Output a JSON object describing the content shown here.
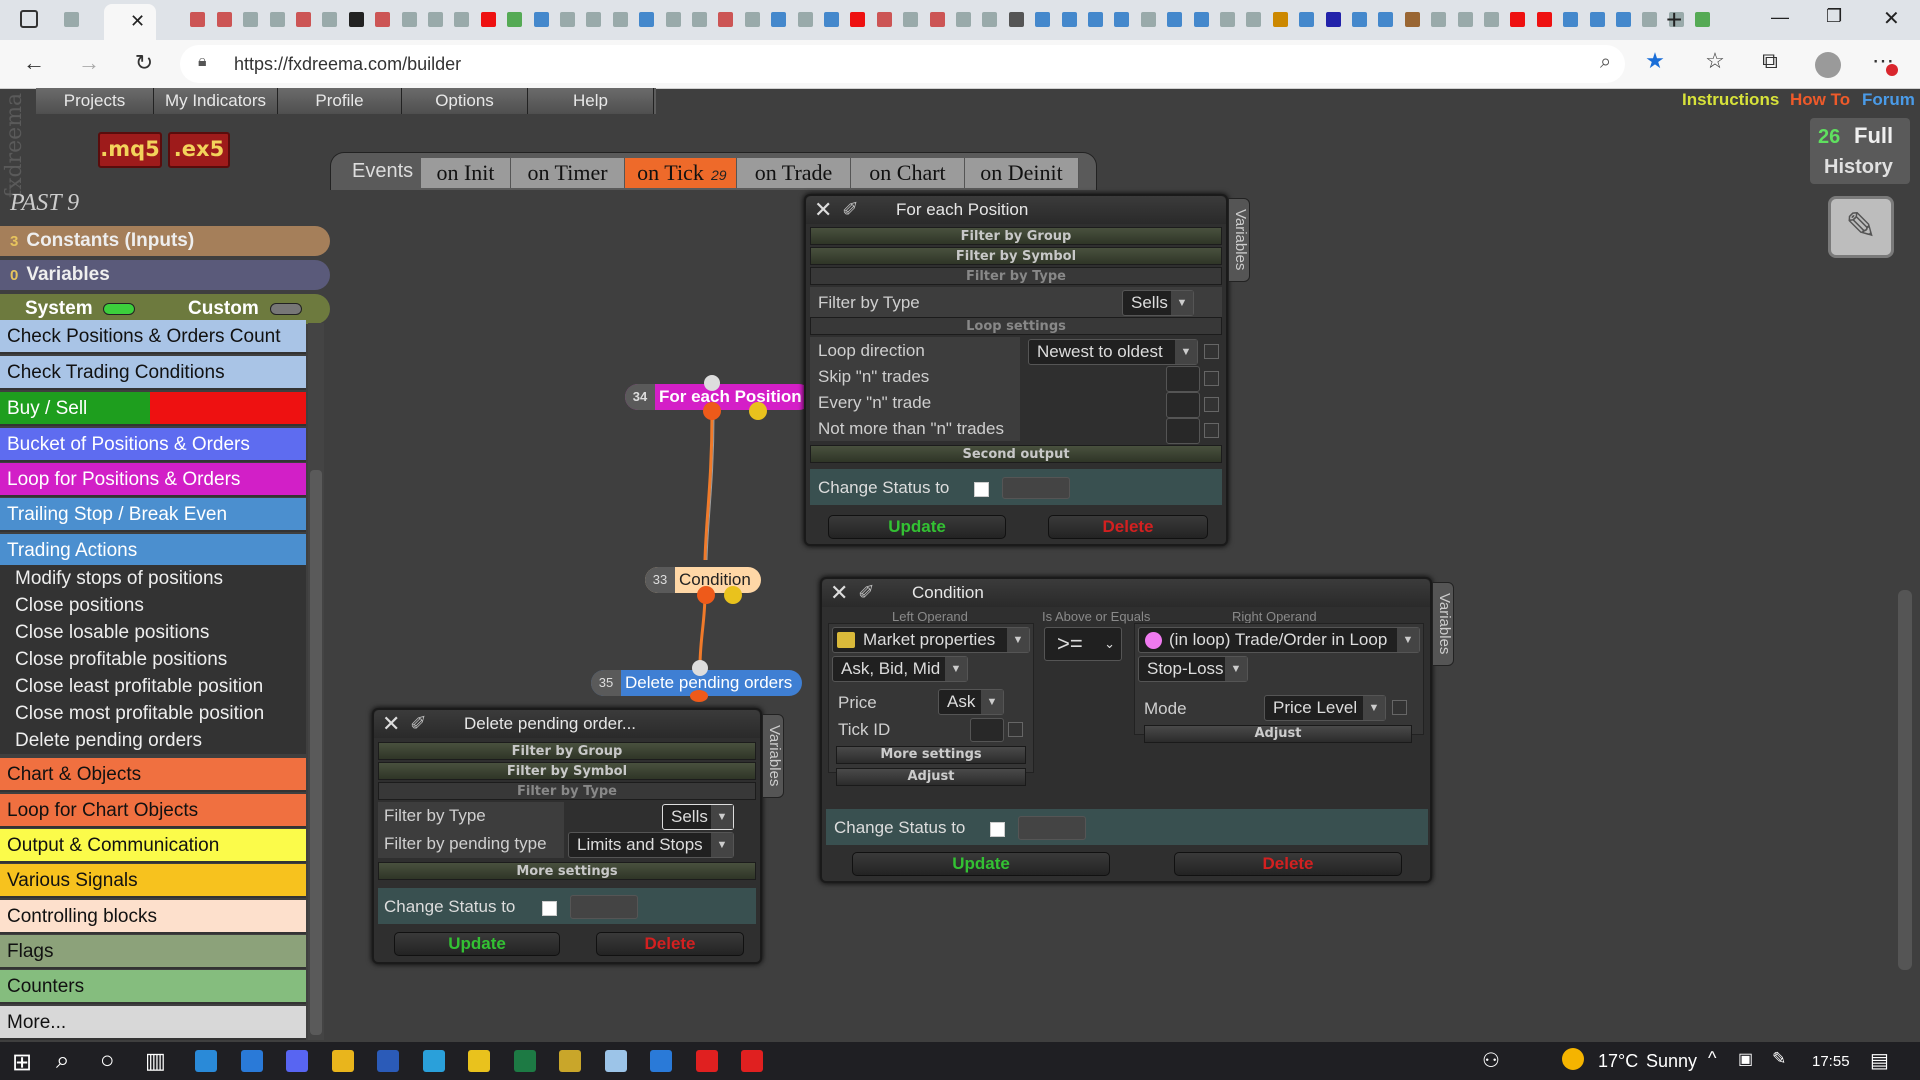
{
  "browser": {
    "url": "https://fxdreema.com/builder",
    "close_tab_label": "✕",
    "new_tab_label": "+",
    "window_minimize": "—",
    "window_restore": "❐",
    "window_close": "✕"
  },
  "app": {
    "logo_text": "fxdreema",
    "menu": [
      "Projects",
      "My Indicators",
      "Profile",
      "Options",
      "Help"
    ],
    "file_buttons": [
      ".mq5",
      ".ex5"
    ],
    "top_links": {
      "instructions": "Instructions",
      "howto": "How To",
      "forum": "Forum"
    },
    "history": {
      "count": "26",
      "full": "Full",
      "label": "History"
    },
    "events": {
      "label": "Events",
      "tabs": [
        "on Init",
        "on Timer",
        "on Tick",
        "on Trade",
        "on Chart",
        "on Deinit"
      ],
      "active": "on Tick",
      "tick_count": "29"
    }
  },
  "sidebar": {
    "past_label": "PAST 9",
    "constants": {
      "count": "3",
      "label": "Constants (Inputs)"
    },
    "variables": {
      "count": "0",
      "label": "Variables"
    },
    "system_label": "System",
    "custom_label": "Custom",
    "categories_top": [
      "Check Positions & Orders Count",
      "Check Trading Conditions",
      "Buy / Sell",
      "Bucket of Positions & Orders",
      "Loop for Positions & Orders",
      "Trailing Stop / Break Even",
      "Trading Actions"
    ],
    "trading_actions_items": [
      "Modify stops of positions",
      "Close positions",
      "Close losable positions",
      "Close profitable positions",
      "Close least profitable position",
      "Close most profitable position",
      "Delete pending orders"
    ],
    "categories_bottom": [
      "Chart & Objects",
      "Loop for Chart Objects",
      "Output & Communication",
      "Various Signals",
      "Controlling blocks",
      "Flags",
      "Counters",
      "More..."
    ]
  },
  "nodes": {
    "for_each": {
      "num": "34",
      "label": "For each Position"
    },
    "condition": {
      "num": "33",
      "label": "Condition"
    },
    "delete_pending": {
      "num": "35",
      "label": "Delete pending orders"
    }
  },
  "panel_for_each": {
    "title": "For each Position",
    "filter_group": "Filter by Group",
    "filter_symbol": "Filter by Symbol",
    "filter_type_section": "Filter by Type",
    "filter_type_label": "Filter by Type",
    "filter_type_value": "Sells",
    "loop_settings": "Loop settings",
    "loop_direction_label": "Loop direction",
    "loop_direction_value": "Newest to oldest",
    "skip_label": "Skip \"n\" trades",
    "every_label": "Every \"n\" trade",
    "notmore_label": "Not more than \"n\" trades",
    "second_output": "Second output",
    "change_status": "Change Status to",
    "update": "Update",
    "delete": "Delete",
    "variables_tab": "Variables"
  },
  "panel_condition": {
    "title": "Condition",
    "left_operand": "Left Operand",
    "operator_label": "Is Above or Equals",
    "right_operand": "Right Operand",
    "left_select": "Market properties",
    "left_sub": "Ask, Bid, Mid",
    "price_label": "Price",
    "price_value": "Ask",
    "tickid_label": "Tick ID",
    "more_settings": "More settings",
    "adjust": "Adjust",
    "operator": ">=",
    "right_select": "(in loop) Trade/Order in Loop",
    "right_sub": "Stop-Loss",
    "mode_label": "Mode",
    "mode_value": "Price Level",
    "right_adjust": "Adjust",
    "change_status": "Change Status to",
    "update": "Update",
    "delete": "Delete",
    "variables_tab": "Variables"
  },
  "panel_delete": {
    "title": "Delete pending order...",
    "filter_group": "Filter by Group",
    "filter_symbol": "Filter by Symbol",
    "filter_type_section": "Filter by Type",
    "filter_type_label": "Filter by Type",
    "filter_type_value": "Sells",
    "pending_type_label": "Filter by pending type",
    "pending_type_value": "Limits and Stops",
    "more_settings": "More settings",
    "change_status": "Change Status to",
    "update": "Update",
    "delete": "Delete",
    "variables_tab": "Variables"
  },
  "taskbar": {
    "weather_temp": "17°C",
    "weather_desc": "Sunny",
    "time": "17:55"
  }
}
